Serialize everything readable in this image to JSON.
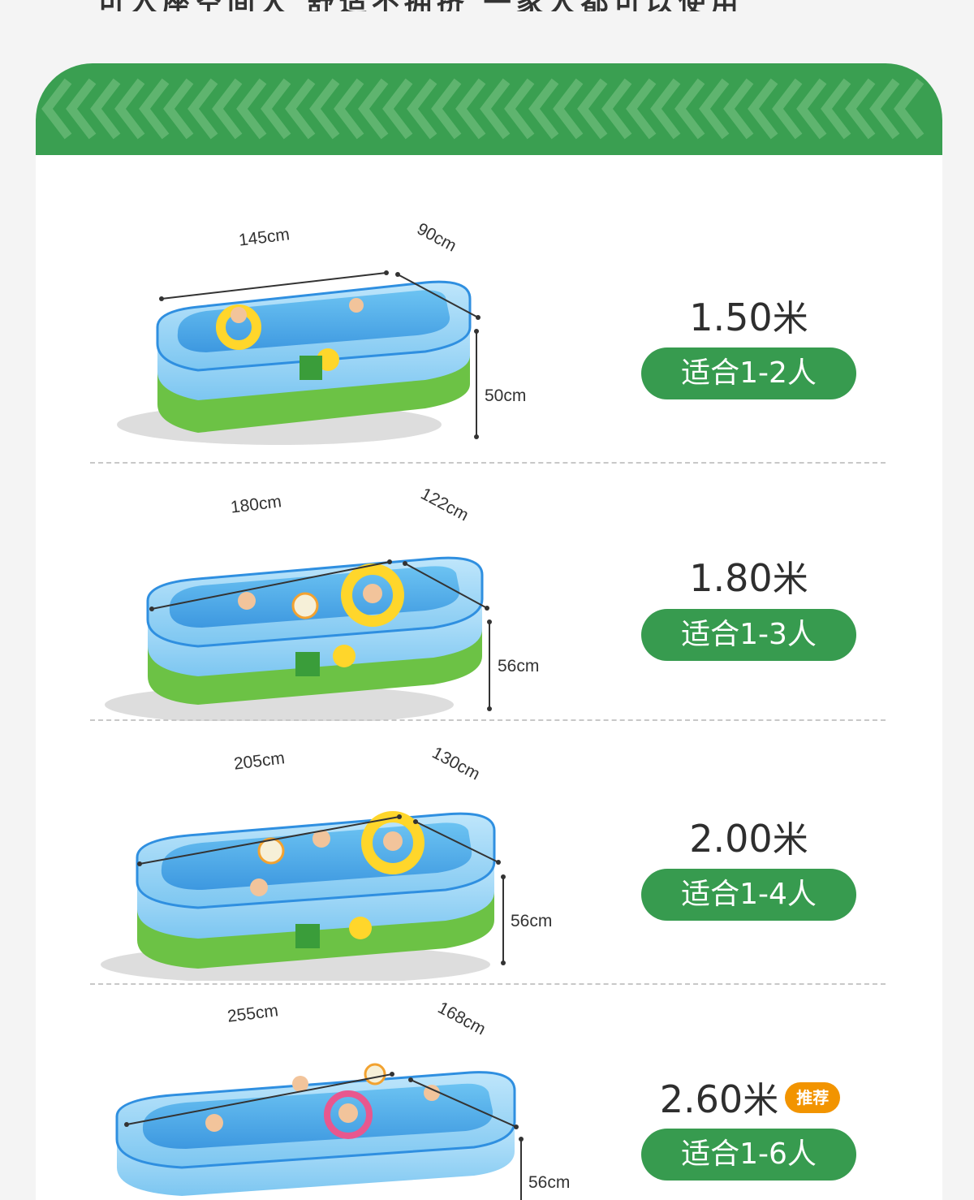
{
  "header_partial_text": "可入座空间大 舒适不拥挤 一家人都可以使用",
  "colors": {
    "brand_green": "#379b4f",
    "recommend_orange": "#f29400"
  },
  "products": [
    {
      "length": "145cm",
      "width": "90cm",
      "height": "50cm",
      "size": "1.50",
      "unit": "米",
      "fit": "适合1-2人",
      "recommended": false
    },
    {
      "length": "180cm",
      "width": "122cm",
      "height": "56cm",
      "size": "1.80",
      "unit": "米",
      "fit": "适合1-3人",
      "recommended": false
    },
    {
      "length": "205cm",
      "width": "130cm",
      "height": "56cm",
      "size": "2.00",
      "unit": "米",
      "fit": "适合1-4人",
      "recommended": false
    },
    {
      "length": "255cm",
      "width": "168cm",
      "height": "56cm",
      "size": "2.60",
      "unit": "米",
      "fit": "适合1-6人",
      "recommended": true,
      "recommend_label": "推荐"
    }
  ]
}
